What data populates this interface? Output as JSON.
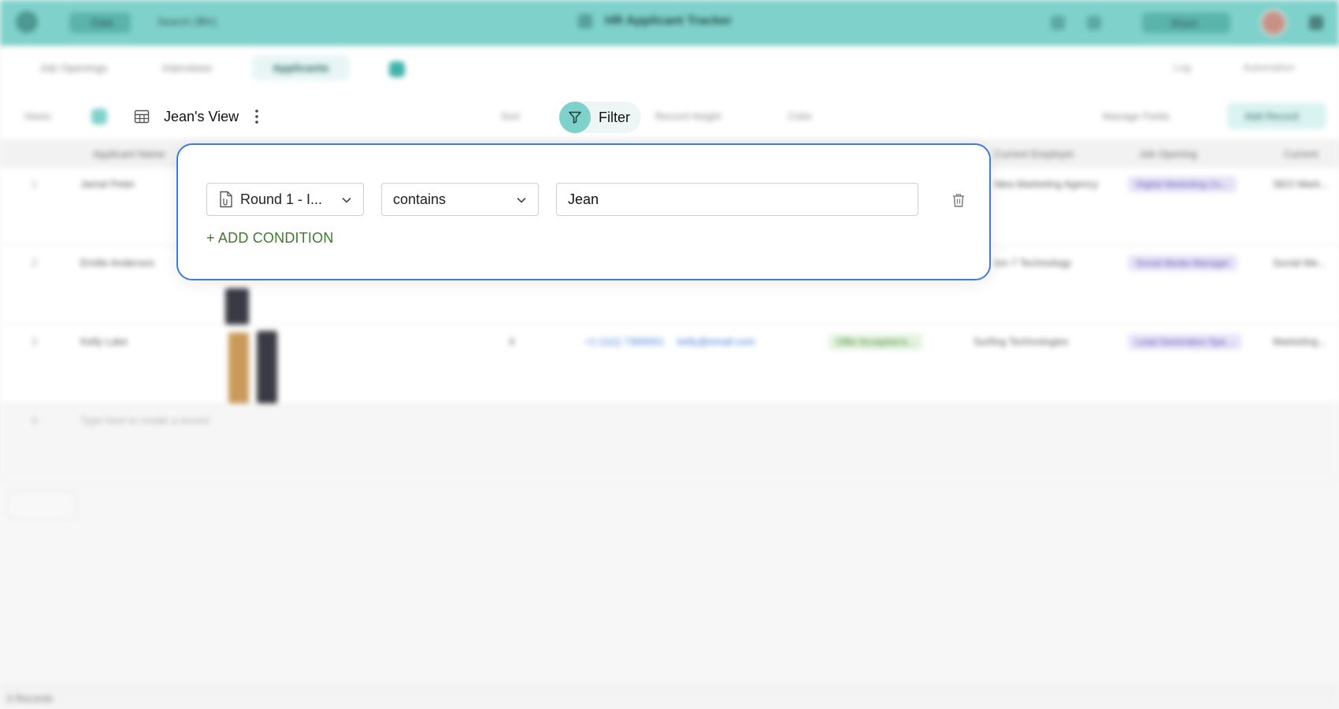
{
  "topbar": {
    "grid_label": "Data",
    "search_label": "Search (⌘K)",
    "app_title": "HR Applicant Tracker",
    "share_label": "Share"
  },
  "tabs": [
    {
      "label": "Job Openings"
    },
    {
      "label": "Interviews"
    },
    {
      "label": "Applicants"
    }
  ],
  "tabs_right": {
    "log": "Log",
    "automation": "Automation"
  },
  "toolbar": {
    "views_label": "Views",
    "view_name": "Jean's View",
    "sort_label": "Sort",
    "filter_label": "Filter",
    "record_height_label": "Record Height",
    "color_label": "Color",
    "manage_fields_label": "Manage Fields",
    "add_record_label": "Add Record"
  },
  "table": {
    "headers": [
      "Applicant Name",
      "Current Employer",
      "Job Opening",
      "Current"
    ],
    "rows": [
      {
        "idx": "1",
        "name": "Jamal Peter",
        "employer": "Idea Marketing Agency",
        "job": "Digital Marketing Co...",
        "current": "SEO Mark..."
      },
      {
        "idx": "2",
        "name": "Emilie Anderson",
        "employer": "Ion 7 Technology",
        "job": "Social Media Manager",
        "current": "Social Me..."
      },
      {
        "idx": "3",
        "name": "Kelly Lake",
        "num": "4",
        "phone": "+1 (111) 7300001",
        "email": "kelly@email.com",
        "status": "Offer Accepted b...",
        "employer": "Surfing Technologies",
        "job": "Lead Generation Spe...",
        "current": "Marketing..."
      }
    ],
    "new_row_hint": "Type here to create a record",
    "new_row_idx": "4",
    "footer": "3 Records"
  },
  "filter": {
    "field_value": "Round 1 - I...",
    "operator_value": "contains",
    "input_value": "Jean",
    "add_condition_label": "+ ADD CONDITION"
  },
  "colors": {
    "accent": "#7fd1cb",
    "panel_border": "#3f7be0",
    "add_condition": "#3d7a2d"
  }
}
